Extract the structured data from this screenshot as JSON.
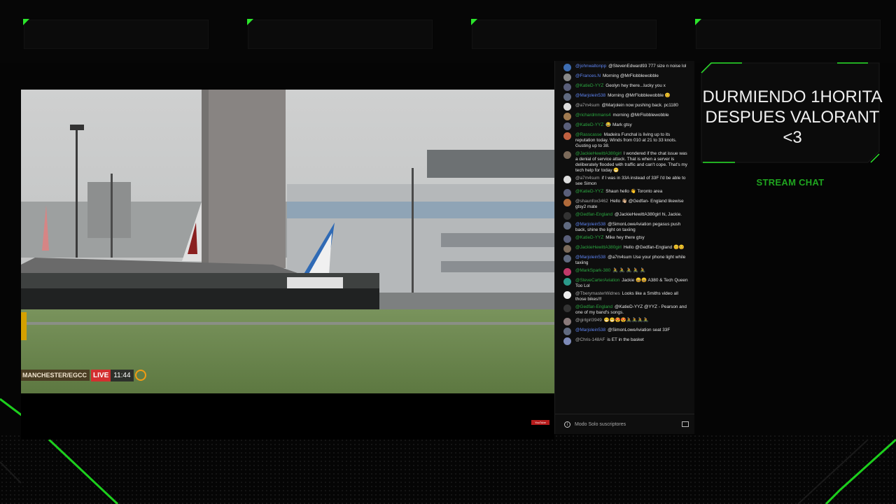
{
  "video": {
    "camera_location": "MANCHESTER/EGCC",
    "live_label": "LIVE",
    "clock": "11:44",
    "source_badge": "YouTube"
  },
  "chat": {
    "footer_mode": "Modo Solo suscriptores",
    "messages": [
      {
        "author": "@johnwaltonpp",
        "role": "mod",
        "text": "@StevenEdward93 777 size n noise lol",
        "avatar_color": "#3d6db3"
      },
      {
        "author": "@Frances.N",
        "role": "mod",
        "text": "Morning @MrFlobblewobble",
        "avatar_color": "#888888"
      },
      {
        "author": "@KatieD-YYZ",
        "role": "member",
        "text": "Geolyn hey there...lucky you x",
        "avatar_color": "#5a5f7a"
      },
      {
        "author": "@Marjolein538",
        "role": "mod",
        "text": "Morning @MrFlobblewobble 😊",
        "avatar_color": "#606a80"
      },
      {
        "author": "@a7m4sum",
        "role": "normal",
        "text": "@Marjolein now pushing back. pc1180",
        "avatar_color": "#dddddd"
      },
      {
        "author": "@richardmmans4",
        "role": "member",
        "text": "morning @MrFlobblewobble",
        "avatar_color": "#a07a50"
      },
      {
        "author": "@KatieD-YYZ",
        "role": "member",
        "text": "😂 Mark gtsy",
        "avatar_color": "#5a5f7a"
      },
      {
        "author": "@Rasscasse",
        "role": "member",
        "text": "Madeira Funchal is living up to its reputation today. Winds from 010 at 21 to 33 knots. Gusting up to 38.",
        "avatar_color": "#c06040"
      },
      {
        "author": "@JackieHewittA380girl",
        "role": "member",
        "text": "I wondered if the chat issue was a denial of service attack. That is when a server is deliberately flooded with traffic and can't cope. That's my tech help for today 😁",
        "avatar_color": "#7b6a5a"
      },
      {
        "author": "@a7m4sum",
        "role": "normal",
        "text": "if I was in 33A instead of 33F I'd be able to see Simon",
        "avatar_color": "#dddddd"
      },
      {
        "author": "@KatieD-YYZ",
        "role": "member",
        "text": "Shaun hello 👋 Toronto area",
        "avatar_color": "#5a5f7a"
      },
      {
        "author": "@shaunfox3462",
        "role": "normal",
        "text": "Hello 👋🏼 @Gedfan- England likewise gtsy2 mate",
        "avatar_color": "#b06a3a"
      },
      {
        "author": "@Gedfan-England",
        "role": "member",
        "text": "@JackieHewittA380girl hi, Jackie.",
        "avatar_color": "#333333"
      },
      {
        "author": "@Marjolein538",
        "role": "mod",
        "text": "@SimonLoweAviation pegasus push back, shine the light on taxiing",
        "avatar_color": "#606a80"
      },
      {
        "author": "@KatieD-YYZ",
        "role": "member",
        "text": "Mike hey there gtsy",
        "avatar_color": "#5a5f7a"
      },
      {
        "author": "@JackieHewittA380girl",
        "role": "member",
        "text": "Hello @Gedfan-England 😊😊",
        "avatar_color": "#7b6a5a"
      },
      {
        "author": "@Marjolein538",
        "role": "mod",
        "text": "@a7m4sum Use your phone light while taxiing",
        "avatar_color": "#606a80"
      },
      {
        "author": "@MarkSpark-380",
        "role": "member",
        "text": "🚴 🚴 🚴 🚴 🚴",
        "avatar_color": "#c0396a"
      },
      {
        "author": "@SteveCarterAviation",
        "role": "member",
        "text": "Jackie 😄😄 A380 & Tech Queen Too Lol",
        "avatar_color": "#2b9a8a"
      },
      {
        "author": "@TberymasterWidnes",
        "role": "normal",
        "text": "Looks like a Smiths video all those bikes!!!",
        "avatar_color": "#eeeeee"
      },
      {
        "author": "@Gedfan-England",
        "role": "member",
        "text": "@KatieD-YYZ @YYZ - Pearson and one of my band's songs.",
        "avatar_color": "#333333"
      },
      {
        "author": "@girlgirl3949",
        "role": "normal",
        "text": "😁😁😍😍🚴🚴🚴🚴",
        "avatar_color": "#8a7a7a"
      },
      {
        "author": "@Marjolein538",
        "role": "mod",
        "text": "@SimonLoweAviation seat 33F",
        "avatar_color": "#606a80"
      },
      {
        "author": "@Chris-148AF",
        "role": "normal",
        "text": "is ET in the basket",
        "avatar_color": "#7d8ab8"
      }
    ]
  },
  "status": {
    "text": "DURMIENDO 1HORITA DESPUES VALORANT <3"
  },
  "labels": {
    "stream_chat": "STREAM CHAT"
  },
  "colors": {
    "accent_green": "#2be62b",
    "label_green": "#1fa51f",
    "live_red": "#d32f2f"
  }
}
